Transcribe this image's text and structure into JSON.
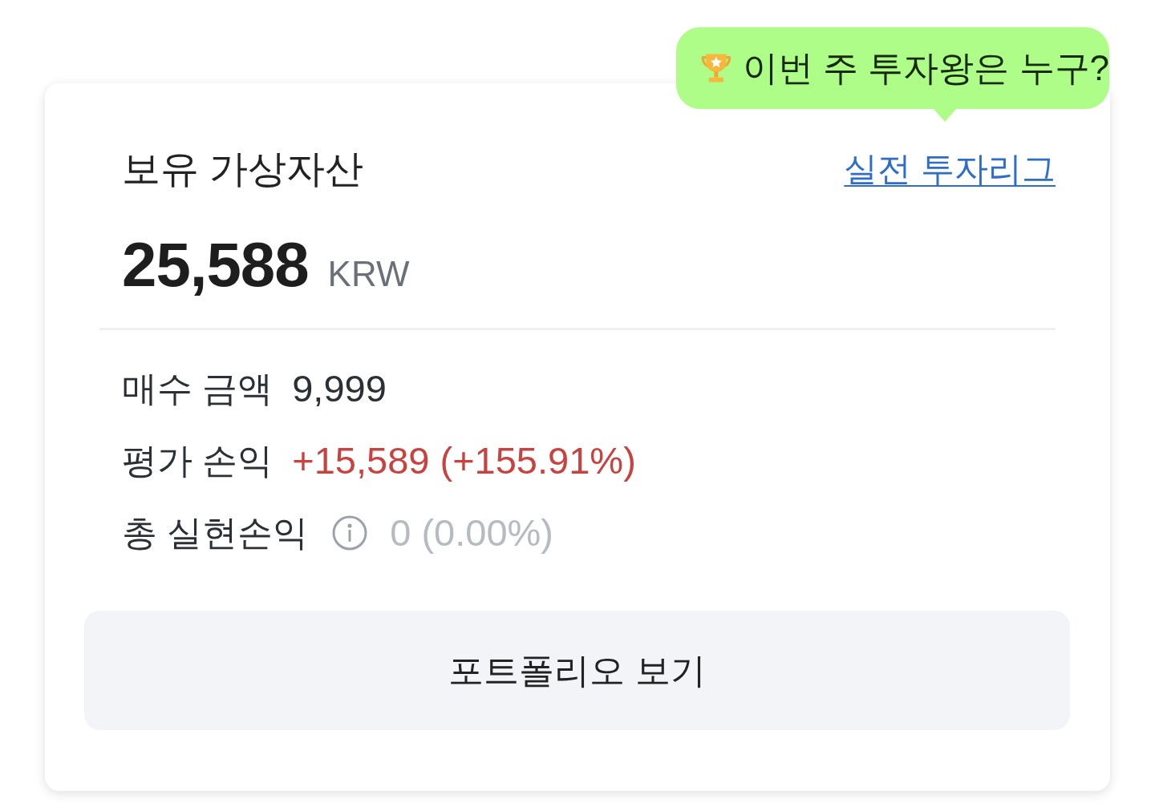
{
  "tooltip": {
    "text": "이번 주 투자왕은 누구?"
  },
  "card": {
    "title": "보유 가상자산",
    "link": "실전 투자리그",
    "balance": {
      "amount": "25,588",
      "currency": "KRW"
    },
    "rows": [
      {
        "kind": "plain",
        "label": "매수 금액",
        "value": "9,999",
        "color": "#2b2f36"
      },
      {
        "kind": "plain",
        "label": "평가 손익",
        "value": "+15,589 (+155.91%)",
        "color": "#c8423f"
      },
      {
        "kind": "info",
        "label": "총 실현손익",
        "value": "0 (0.00%)",
        "color": "#b6bac1"
      }
    ],
    "button": "포트폴리오 보기"
  }
}
